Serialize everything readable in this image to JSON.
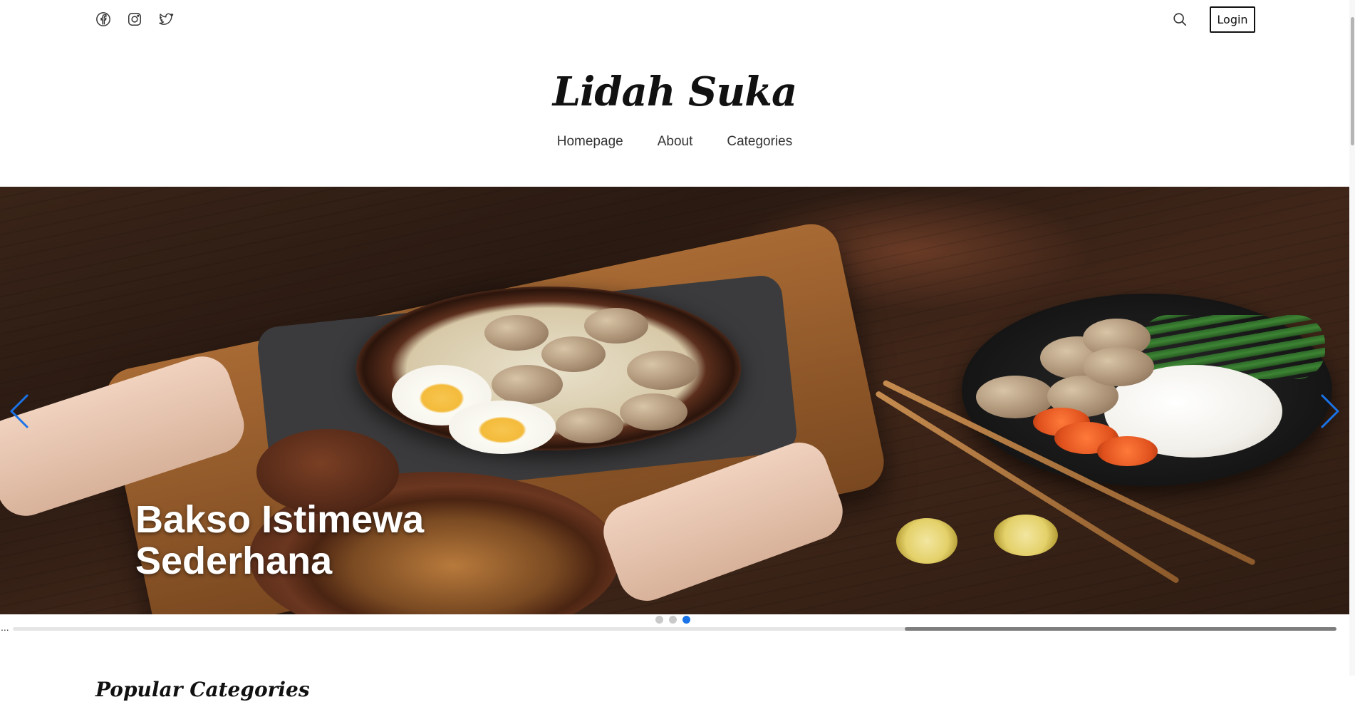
{
  "header": {
    "social_icons": [
      "facebook-icon",
      "instagram-icon",
      "twitter-icon"
    ],
    "search_icon": "search-icon",
    "login_label": "Login"
  },
  "brand": {
    "name": "Lidah Suka"
  },
  "nav": {
    "items": [
      {
        "label": "Homepage"
      },
      {
        "label": "About"
      },
      {
        "label": "Categories"
      }
    ]
  },
  "hero": {
    "caption_line1": "Bakso Istimewa",
    "caption_line2": "Sederhana",
    "active_slide": 3,
    "slide_count": 3,
    "prev_icon": "chevron-left-icon",
    "next_icon": "chevron-right-icon",
    "accent_color": "#1a73e8"
  },
  "misc": {
    "ellipsis": "..."
  },
  "section": {
    "title": "Popular Categories"
  }
}
